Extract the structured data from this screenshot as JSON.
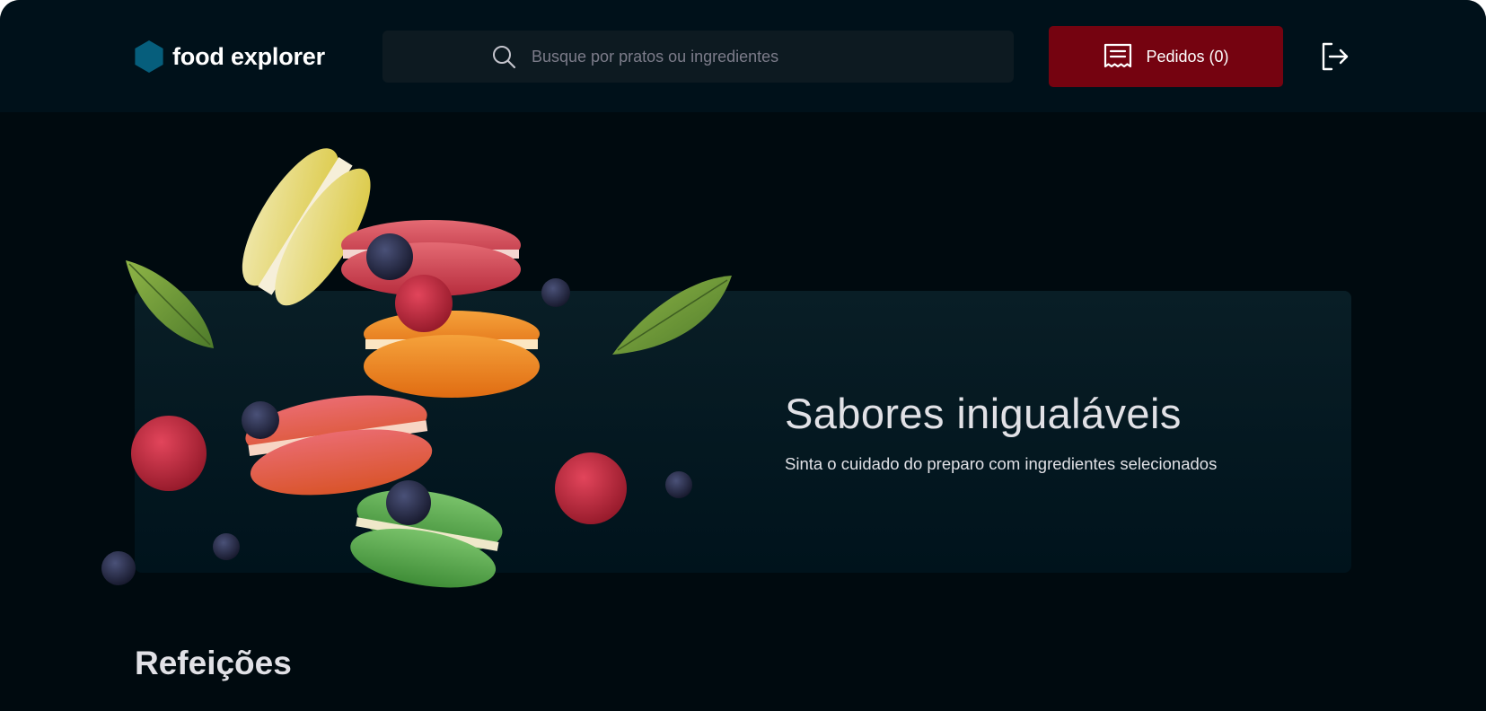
{
  "header": {
    "brand_name": "food explorer",
    "brand_color": "#065e7c",
    "search": {
      "placeholder": "Busque por pratos ou ingredientes",
      "icon": "search-icon"
    },
    "orders_button": {
      "label": "Pedidos (0)",
      "icon": "receipt-icon",
      "color": "#750310"
    },
    "logout_icon": "sign-out-icon"
  },
  "banner": {
    "title": "Sabores inigualáveis",
    "subtitle": "Sinta o cuidado do preparo com ingredientes selecionados",
    "image": "macarons-illustration"
  },
  "sections": [
    {
      "title": "Refeições"
    }
  ]
}
